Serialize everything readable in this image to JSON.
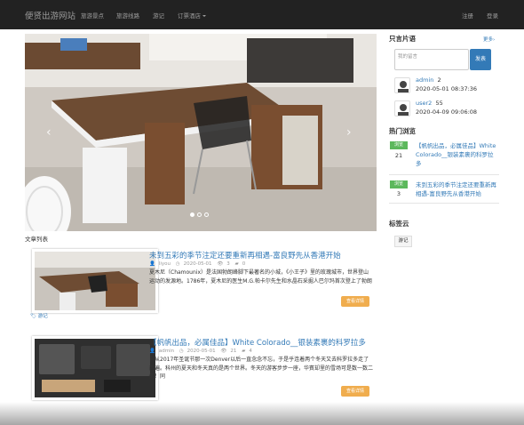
{
  "navbar": {
    "brand": "便贤出游网站",
    "items": [
      "旅游景点",
      "旅游线路",
      "游记",
      "订票酒店"
    ],
    "right_items": [
      "注册",
      "登录"
    ]
  },
  "carousel": {
    "prev": "‹",
    "next": "›",
    "slide_count": 3,
    "active_index": 0
  },
  "articles_section": {
    "label": "文章列表"
  },
  "articles": [
    {
      "title": "未到五彩的季节注定还要重新再相遇-富良野先从香港开始",
      "author": "liyou",
      "date": "2020-05-01",
      "views": "3",
      "comments": "0",
      "excerpt": "夏木尼（Chamounix）是法国勃朗峰脚下最著名的小城，《小王子》里的玫瑰城市，世界登山运动的发源地。1786年，夏木尼的医生M.G.帕卡尔先生和水晶石采掘人巴尔玛首次登上了勃朗",
      "button": "查看详情",
      "tag": "游记"
    },
    {
      "title": "【帆帆出品，必属佳品】White Colorado__银装素裹的科罗拉多",
      "author": "admin",
      "date": "2020-05-01",
      "views": "21",
      "comments": "4",
      "excerpt": "自从2017年圣诞节那一次Denver以后一直念念不忘，于是乎连着两个冬天又去科罗拉多走了两遍。科州的夏天和冬天真的是两个世界。冬天的游客步步一座，华賓却里的雪场可是数一数二的！同",
      "button": "查看详情"
    }
  ],
  "sidebar": {
    "messages": {
      "title": "只言片语",
      "more": "更多›",
      "placeholder": "我的留言",
      "send": "发表",
      "items": [
        {
          "user": "admin",
          "text": "2",
          "time": "2020-05-01 08:37:36"
        },
        {
          "user": "user2",
          "text": "55",
          "time": "2020-04-09 09:06:08"
        }
      ]
    },
    "hot": {
      "title": "热门浏览",
      "items": [
        {
          "badge": "浏览",
          "count": "21",
          "title": "【帆帆出品，必属佳品】White Colorado__银装素裹的科罗拉多"
        },
        {
          "badge": "浏览",
          "count": "3",
          "title": "未到五彩的季节注定还要重新再相遇-富良野先从香港开始"
        }
      ]
    },
    "tags": {
      "title": "标签云",
      "items": [
        "游记"
      ]
    }
  },
  "colors": {
    "navbar": "#222222",
    "link": "#337ab7",
    "warning": "#f0ad4e",
    "success": "#5cb85c"
  }
}
